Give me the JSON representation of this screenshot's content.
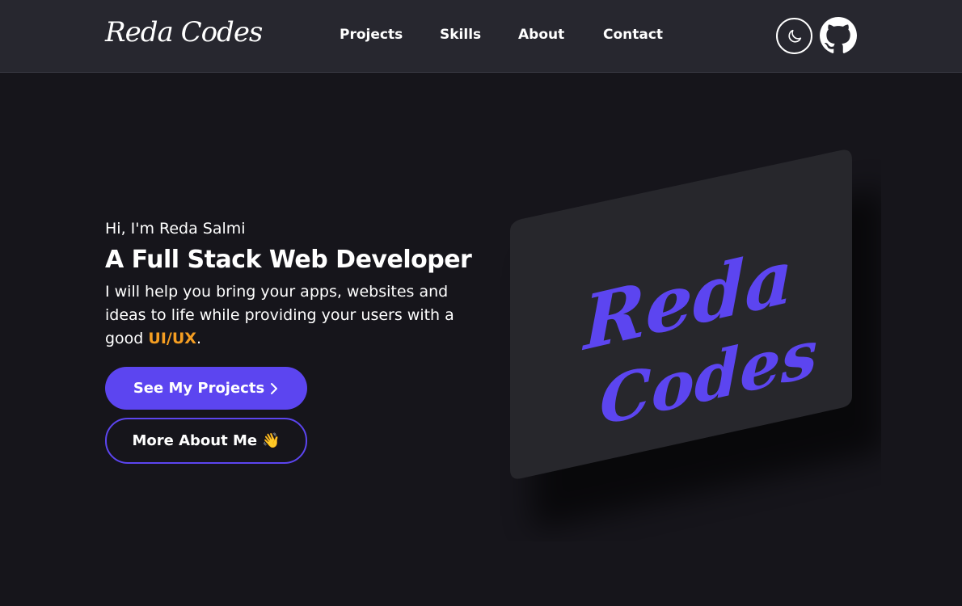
{
  "header": {
    "logo": "Reda Codes",
    "nav": [
      {
        "label": "Projects"
      },
      {
        "label": "Skills"
      },
      {
        "label": "About"
      },
      {
        "label": "Contact"
      }
    ],
    "theme_toggle_icon": "moon-icon",
    "github_icon": "github-icon"
  },
  "hero": {
    "greeting": "Hi, I'm Reda Salmi",
    "title": "A Full Stack Web Developer",
    "description_before": "I will help you bring your apps, websites and ideas to life while providing your users with a good ",
    "description_accent": "UI/UX",
    "description_after": ".",
    "primary_button": "See My Projects",
    "primary_button_icon": "chevron-right-icon",
    "secondary_button": "More About Me",
    "secondary_button_emoji": "👋",
    "art_line1": "Reda",
    "art_line2": "Codes"
  },
  "colors": {
    "background": "#16151b",
    "header": "#27272f",
    "accent_purple": "#5c45f0",
    "accent_orange": "#f59e22",
    "card": "#27272c"
  }
}
